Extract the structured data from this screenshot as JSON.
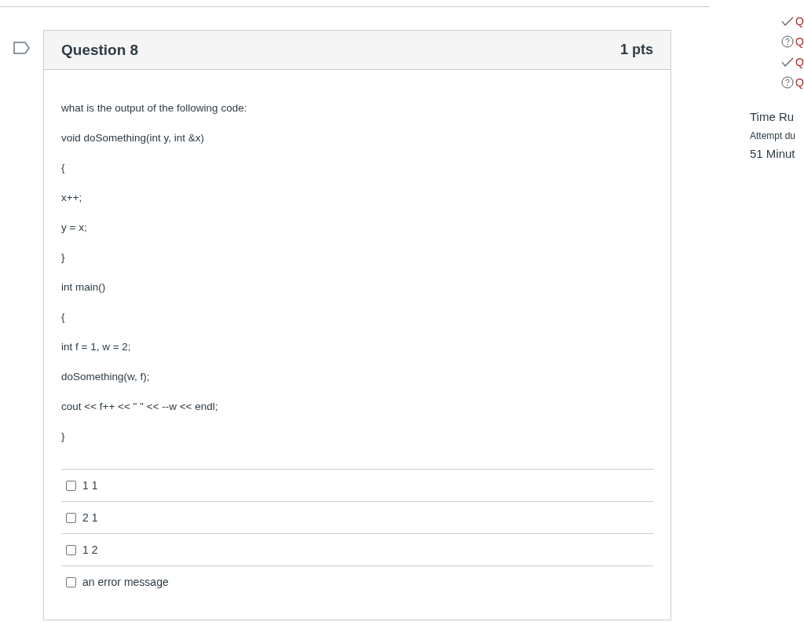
{
  "question": {
    "title": "Question 8",
    "points": "1 pts",
    "prompt": "what is the output of the following code:",
    "code_lines": [
      "void doSomething(int y, int &x)",
      "{",
      "x++;",
      "y = x;",
      "}",
      "int main()",
      "{",
      "int f = 1, w = 2;",
      "doSomething(w, f);",
      "cout << f++ << \" \" << --w << endl;",
      "}"
    ],
    "answers": [
      {
        "label": "1 1",
        "checked": false
      },
      {
        "label": "2 1",
        "checked": false
      },
      {
        "label": "1 2",
        "checked": false
      },
      {
        "label": "an error message",
        "checked": false
      }
    ]
  },
  "sidebar": {
    "questions": [
      {
        "kind": "answered",
        "label": "Q"
      },
      {
        "kind": "unanswered",
        "label": "Q"
      },
      {
        "kind": "answered",
        "label": "Q"
      },
      {
        "kind": "unanswered",
        "label": "Q"
      }
    ],
    "timer_title": "Time Ru",
    "timer_note": "Attempt du",
    "timer_value": "51 Minut"
  }
}
